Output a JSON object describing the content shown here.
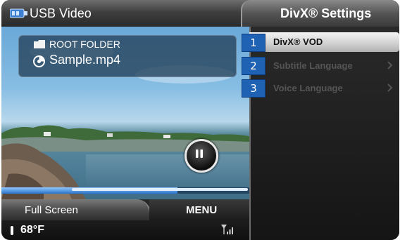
{
  "header": {
    "title": "USB Video",
    "settings_title": "DivX® Settings",
    "usb_icon": "usb-icon"
  },
  "video": {
    "folder_label": "ROOT FOLDER",
    "file_label": "Sample.mp4",
    "progress": 0.71,
    "pause_icon": "pause-icon"
  },
  "settings_menu": {
    "items": [
      {
        "number": "1",
        "label": "DivX® VOD",
        "state": "selected"
      },
      {
        "number": "2",
        "label": "Subtitle Language",
        "state": "disabled",
        "chevron": "chevron-right-icon"
      },
      {
        "number": "3",
        "label": "Voice Language",
        "state": "disabled",
        "chevron": "chevron-right-icon"
      }
    ]
  },
  "bottom_bar": {
    "full_screen_label": "Full Screen",
    "menu_label": "MENU",
    "temperature": "68°F",
    "signal_icon": "signal-strength-icon",
    "temp_icon": "thermometer-icon"
  },
  "colors": {
    "badge_blue": "#1f62b4",
    "progress_blue": "#2a73c9"
  }
}
